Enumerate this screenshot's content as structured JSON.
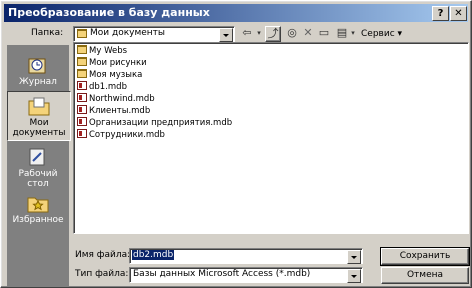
{
  "window": {
    "title": "Преобразование в базу данных",
    "help_glyph": "?",
    "close_glyph": "✕"
  },
  "lookin": {
    "label": "Папка:",
    "value": "Мои документы"
  },
  "toolbar": {
    "tools_label": "Сервис"
  },
  "places": [
    {
      "label": "Журнал",
      "icon": "history-icon"
    },
    {
      "label": "Мои документы",
      "icon": "my-documents-icon"
    },
    {
      "label": "Рабочий стол",
      "icon": "desktop-icon"
    },
    {
      "label": "Избранное",
      "icon": "favorites-icon"
    }
  ],
  "files": [
    {
      "name": "My Webs",
      "kind": "folder"
    },
    {
      "name": "Мои рисунки",
      "kind": "folder"
    },
    {
      "name": "Моя музыка",
      "kind": "folder"
    },
    {
      "name": "db1.mdb",
      "kind": "mdb"
    },
    {
      "name": "Northwind.mdb",
      "kind": "mdb"
    },
    {
      "name": "Клиенты.mdb",
      "kind": "mdb"
    },
    {
      "name": "Организации предприятия.mdb",
      "kind": "mdb"
    },
    {
      "name": "Сотрудники.mdb",
      "kind": "mdb"
    }
  ],
  "filename": {
    "label": "Имя файла:",
    "value": "db2.mdb"
  },
  "filetype": {
    "label": "Тип файла:",
    "value": "Базы данных Microsoft Access (*.mdb)"
  },
  "buttons": {
    "save": "Сохранить",
    "cancel": "Отмена"
  }
}
